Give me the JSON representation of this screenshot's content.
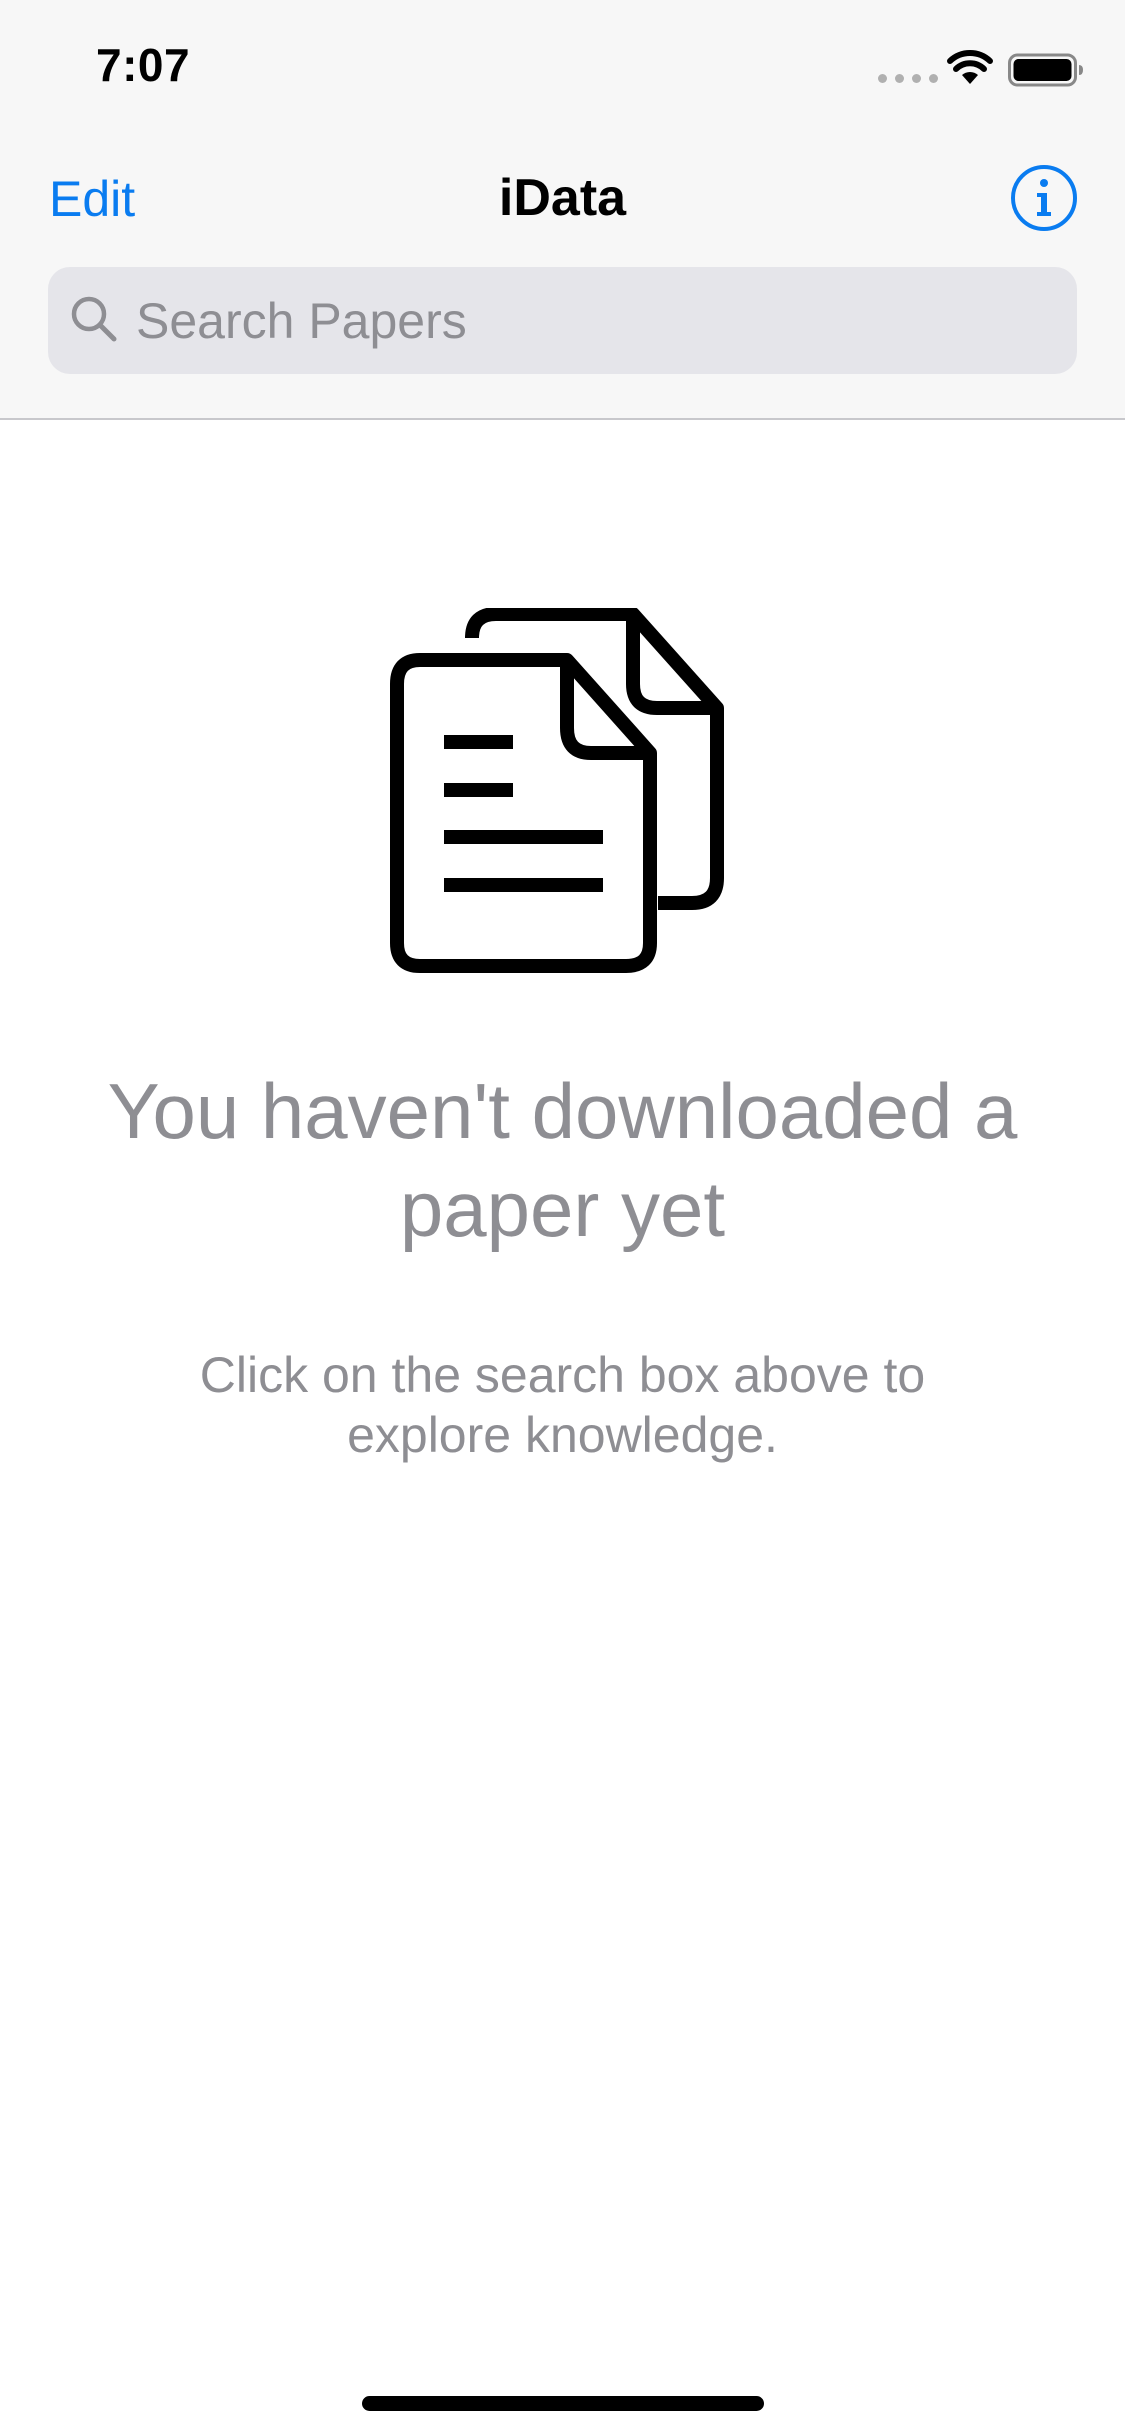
{
  "status_bar": {
    "time": "7:07"
  },
  "nav": {
    "edit_label": "Edit",
    "title": "iData",
    "info_icon": "info-circle-icon"
  },
  "search": {
    "placeholder": "Search Papers",
    "value": ""
  },
  "empty_state": {
    "icon": "documents-icon",
    "title": "You haven't downloaded a paper yet",
    "subtitle": "Click on the search box above to explore knowledge."
  },
  "colors": {
    "accent": "#0a7cf0",
    "muted_text": "#8e8e93",
    "nav_background": "#f7f7f7",
    "search_background": "#e5e5ea"
  }
}
